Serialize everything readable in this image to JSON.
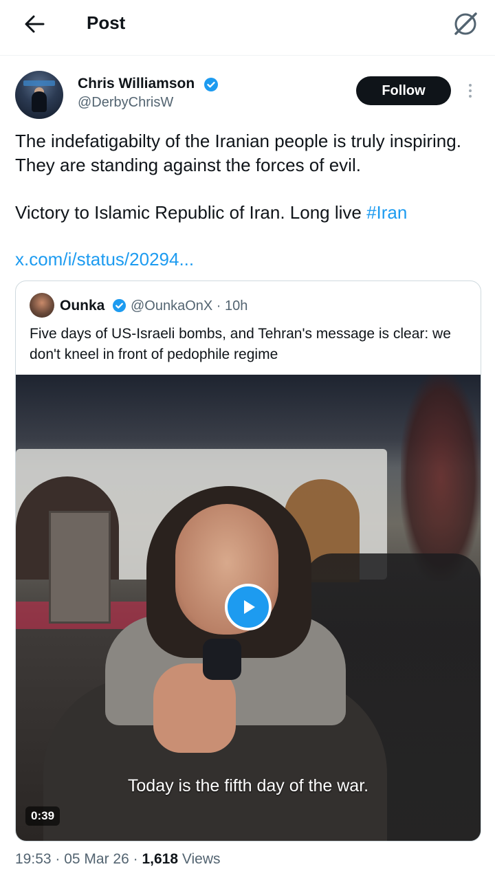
{
  "header": {
    "title": "Post",
    "back_icon": "arrow-left-icon",
    "grok_icon": "grok-icon"
  },
  "author": {
    "name": "Chris Williamson",
    "handle": "@DerbyChrisW",
    "verified": true,
    "follow_label": "Follow"
  },
  "tweet": {
    "text_line1": "The indefatigabilty of the Iranian people is truly inspiring. They are standing against the forces of evil.",
    "text_line2_prefix": "Victory to Islamic Republic of Iran. Long live ",
    "hashtag": "#Iran",
    "link": "x.com/i/status/20294..."
  },
  "quoted": {
    "name": "Ounka",
    "handle": "@OunkaOnX",
    "time": " · 10h",
    "verified": true,
    "text": "Five days of US-Israeli bombs, and Tehran's message is clear: we don't kneel in front of pedophile regime",
    "video": {
      "caption": "Today is the fifth day of the war.",
      "duration": "0:39"
    }
  },
  "meta": {
    "time": "19:53",
    "sep1": " · ",
    "date": "05 Mar 26",
    "sep2": " · ",
    "views_count": "1,618",
    "views_label": " Views"
  },
  "colors": {
    "accent": "#1d9bf0",
    "text": "#0f1419",
    "secondary": "#536471"
  }
}
